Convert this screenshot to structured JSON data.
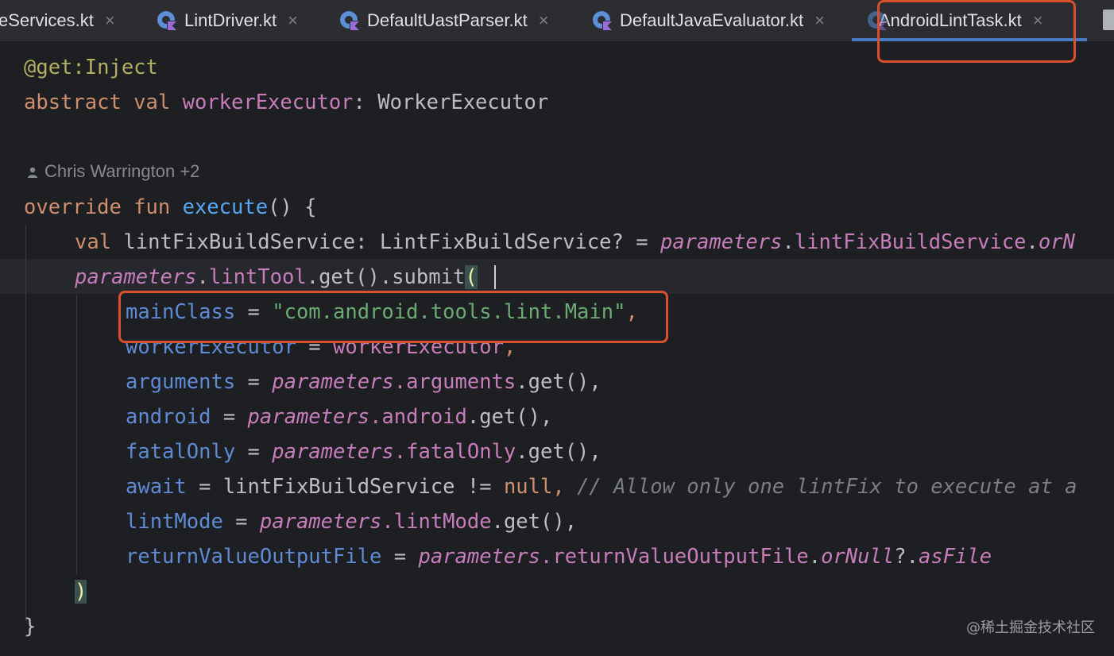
{
  "tabs": [
    {
      "label": "eServices.kt",
      "active": false
    },
    {
      "label": "LintDriver.kt",
      "active": false
    },
    {
      "label": "DefaultUastParser.kt",
      "active": false
    },
    {
      "label": "DefaultJavaEvaluator.kt",
      "active": false
    },
    {
      "label": "AndroidLintTask.kt",
      "active": true
    }
  ],
  "close_glyph": "×",
  "author_hint": "Chris Warrington +2",
  "code": {
    "l1_ann": "@get:Inject",
    "l2_kw": "abstract val",
    "l2_prop": "workerExecutor",
    "l2_rest": ": WorkerExecutor",
    "l4_kw": "override fun",
    "l4_fn": "execute",
    "l4_rest": "() {",
    "l5_kw": "val",
    "l5_name": "lintFixBuildService",
    "l5_type": ": LintFixBuildService? =",
    "l5_param": "parameters",
    "l5_dot": ".",
    "l5_prop": "lintFixBuildService",
    "l5_dot2": ".",
    "l5_tail": "orN",
    "l6_param": "parameters",
    "l6_dot": ".",
    "l6_prop": "lintTool",
    "l6_rest": ".get().submit",
    "l6_paren": "(",
    "l7_named": "mainClass",
    "l7_eq": " = ",
    "l7_str": "\"com.android.tools.lint.Main\"",
    "l7_comma": ",",
    "l8_named": "workerExecutor",
    "l8_eq": " = ",
    "l8_val": "workerExecutor",
    "l8_comma": ",",
    "l9_named": "arguments",
    "l9_eq": " = ",
    "l9_param": "parameters",
    "l9_prop": ".arguments",
    "l9_rest": ".get(),",
    "l10_named": "android",
    "l10_eq": " = ",
    "l10_param": "parameters",
    "l10_prop": ".android",
    "l10_rest": ".get(),",
    "l11_named": "fatalOnly",
    "l11_eq": " = ",
    "l11_param": "parameters",
    "l11_prop": ".fatalOnly",
    "l11_rest": ".get(),",
    "l12_named": "await",
    "l12_eq": " = ",
    "l12_val": "lintFixBuildService != ",
    "l12_null": "null",
    "l12_comma": ", ",
    "l12_cm": "// Allow only one lintFix to execute at a",
    "l13_named": "lintMode",
    "l13_eq": " = ",
    "l13_param": "parameters",
    "l13_prop": ".lintMode",
    "l13_rest": ".get(),",
    "l14_named": "returnValueOutputFile",
    "l14_eq": " = ",
    "l14_param": "parameters",
    "l14_prop": ".returnValueOutputFile",
    "l14_dot": ".",
    "l14_ext": "orNull",
    "l14_q": "?.",
    "l14_ext2": "asFile",
    "l15_paren": ")",
    "l16_brace": "}"
  },
  "watermark": "@稀土掘金技术社区",
  "colors": {
    "background": "#1e1f22",
    "tabbar": "#2b2d30",
    "highlight_box": "#d9512c",
    "active_tab_underline": "#4a78c2"
  }
}
